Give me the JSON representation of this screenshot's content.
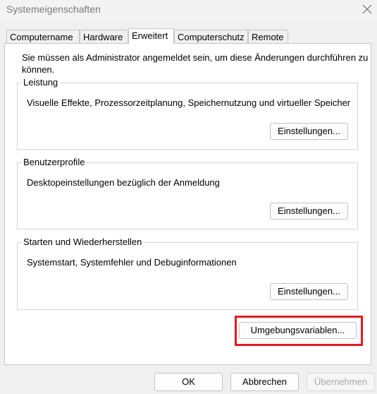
{
  "window": {
    "title": "Systemeigenschaften",
    "close_icon": "close-icon"
  },
  "tabs": [
    {
      "label": "Computername",
      "active": false
    },
    {
      "label": "Hardware",
      "active": false
    },
    {
      "label": "Erweitert",
      "active": true
    },
    {
      "label": "Computerschutz",
      "active": false
    },
    {
      "label": "Remote",
      "active": false
    }
  ],
  "panel": {
    "intro": "Sie müssen als Administrator angemeldet sein, um diese Änderungen durchführen zu können.",
    "groups": [
      {
        "title": "Leistung",
        "description": "Visuelle Effekte, Prozessorzeitplanung, Speichernutzung und virtueller Speicher",
        "button": "Einstellungen..."
      },
      {
        "title": "Benutzerprofile",
        "description": "Desktopeinstellungen bezüglich der Anmeldung",
        "button": "Einstellungen..."
      },
      {
        "title": "Starten und Wiederherstellen",
        "description": "Systemstart, Systemfehler und Debuginformationen",
        "button": "Einstellungen..."
      }
    ],
    "env_button": "Umgebungsvariablen...",
    "highlight_color": "#e11a22"
  },
  "footer": {
    "ok": "OK",
    "cancel": "Abbrechen",
    "apply": "Übernehmen",
    "apply_enabled": false
  }
}
